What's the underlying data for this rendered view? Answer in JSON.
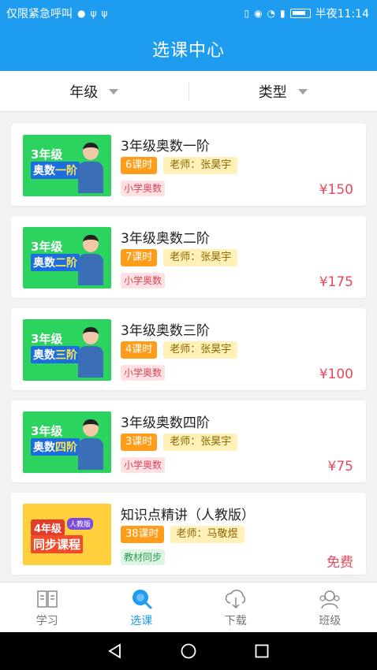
{
  "status": {
    "carrier": "仅限紧急呼叫",
    "time": "半夜11:14"
  },
  "header": {
    "title": "选课中心"
  },
  "filters": [
    {
      "label": "年级"
    },
    {
      "label": "类型"
    }
  ],
  "courses": [
    {
      "title": "3年级奥数一阶",
      "hours": "6课时",
      "teacher": "老师：张昊宇",
      "category": "小学奥数",
      "price": "¥150",
      "thumb": {
        "line1": "3年级",
        "line2a": "奥数",
        "line2b": "一阶"
      }
    },
    {
      "title": "3年级奥数二阶",
      "hours": "7课时",
      "teacher": "老师：张昊宇",
      "category": "小学奥数",
      "price": "¥175",
      "thumb": {
        "line1": "3年级",
        "line2a": "奥数",
        "line2b": "二阶"
      }
    },
    {
      "title": "3年级奥数三阶",
      "hours": "4课时",
      "teacher": "老师：张昊宇",
      "category": "小学奥数",
      "price": "¥100",
      "thumb": {
        "line1": "3年级",
        "line2a": "奥数",
        "line2b": "三阶"
      }
    },
    {
      "title": "3年级奥数四阶",
      "hours": "3课时",
      "teacher": "老师：张昊宇",
      "category": "小学奥数",
      "price": "¥75",
      "thumb": {
        "line1": "3年级",
        "line2a": "奥数",
        "line2b": "四阶"
      }
    },
    {
      "title": "知识点精讲（人教版）",
      "hours": "38课时",
      "teacher": "老师：马敬煜",
      "category": "教材同步",
      "price": "免费",
      "thumb": {
        "line1": "4年级",
        "line2a": "同步课程",
        "line2b": "",
        "badge": "人教版"
      }
    }
  ],
  "tabs": [
    {
      "label": "学习",
      "icon": "book-icon"
    },
    {
      "label": "选课",
      "icon": "search-icon"
    },
    {
      "label": "下载",
      "icon": "cloud-download-icon"
    },
    {
      "label": "班级",
      "icon": "people-icon"
    }
  ],
  "colors": {
    "brand": "#1e9cf0",
    "price": "#e8485b",
    "hours_tag": "#ff9d1b"
  }
}
